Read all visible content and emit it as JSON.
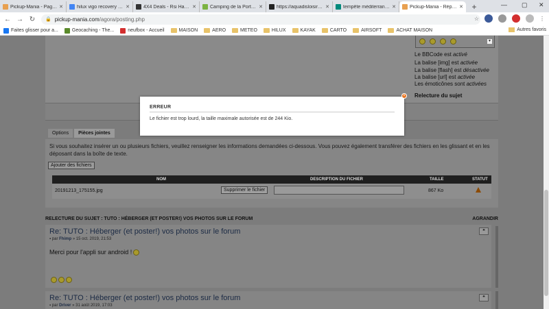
{
  "browser": {
    "tabs": [
      {
        "title": "Pickup-Mania - Page d",
        "color": "#e8a050"
      },
      {
        "title": "hilux vigo recovery poi",
        "color": "#4285f4"
      },
      {
        "title": "4X4 Deals - Rsi Hardto",
        "color": "#333333"
      },
      {
        "title": "Camping de la Porte d",
        "color": "#7cb342"
      },
      {
        "title": "https://aquadisloisirs.s",
        "color": "#222222"
      },
      {
        "title": "tempête méditerranée",
        "color": "#00897b"
      },
      {
        "title": "Pickup-Mania - Répon",
        "color": "#e8a050"
      }
    ],
    "url_domain": "pickup-mania.com",
    "url_path": "/agora/posting.php",
    "bookmarks": [
      {
        "label": "Faites glisser pour a...",
        "type": "icon",
        "color": "#1877f2"
      },
      {
        "label": "Geocaching - The...",
        "type": "icon",
        "color": "#5a8a2a"
      },
      {
        "label": "neufbox - Accueil",
        "type": "icon",
        "color": "#d32f2f"
      },
      {
        "label": "MAISON",
        "type": "folder"
      },
      {
        "label": "AERO",
        "type": "folder"
      },
      {
        "label": "METEO",
        "type": "folder"
      },
      {
        "label": "HILUX",
        "type": "folder"
      },
      {
        "label": "KAYAK",
        "type": "folder"
      },
      {
        "label": "CARTO",
        "type": "folder"
      },
      {
        "label": "AIRSOFT",
        "type": "folder"
      },
      {
        "label": "ACHAT MAISON",
        "type": "folder"
      }
    ],
    "other_bookmarks": "Autres favoris"
  },
  "sidebar": {
    "bbcode": {
      "prefix": "Le BBCode est ",
      "state": "activé"
    },
    "img": {
      "prefix": "La balise [img] est ",
      "state": "activée"
    },
    "flash": {
      "prefix": "La balise [flash] est ",
      "state": "désactivée"
    },
    "url": {
      "prefix": "La balise [url] est ",
      "state": "activée"
    },
    "emoticons": {
      "prefix": "Les émoticônes sont ",
      "state": "activées"
    },
    "review": "Relecture du sujet"
  },
  "attachments": {
    "tabs": [
      "Options",
      "Pièces jointes"
    ],
    "intro": "Si vous souhaitez insérer un ou plusieurs fichiers, veuillez renseigner les informations demandées ci-dessous. Vous pouvez également transférer des fichiers en les glissant et en les déposant dans la boîte de texte.",
    "add_button": "Ajouter des fichiers",
    "columns": {
      "name": "NOM",
      "description": "DESCRIPTION DU FICHIER",
      "size": "TAILLE",
      "status": "STATUT"
    },
    "file": {
      "name": "20191213_175155.jpg",
      "delete_button": "Supprimer le fichier",
      "size": "867 Ko"
    }
  },
  "review_bar": {
    "title": "RELECTURE DU SUJET : TUTO : HÉBERGER (ET POSTER!) VOS PHOTOS SUR LE FORUM",
    "expand": "AGRANDIR"
  },
  "posts": [
    {
      "title": "Re: TUTO : Héberger (et poster!) vos photos sur le forum",
      "by": "par",
      "author": "Fhimp",
      "date": "» 15 oct. 2019, 21:53",
      "body": "Merci pour l'appli sur android !"
    },
    {
      "title": "Re: TUTO : Héberger (et poster!) vos photos sur le forum",
      "by": "par",
      "author": "Driver",
      "date": "» 31 août 2019, 17:03",
      "body": ""
    }
  ],
  "modal": {
    "title": "ERREUR",
    "message": "Le fichier est trop lourd, la taille maximale autorisée est de 244 Kio."
  }
}
